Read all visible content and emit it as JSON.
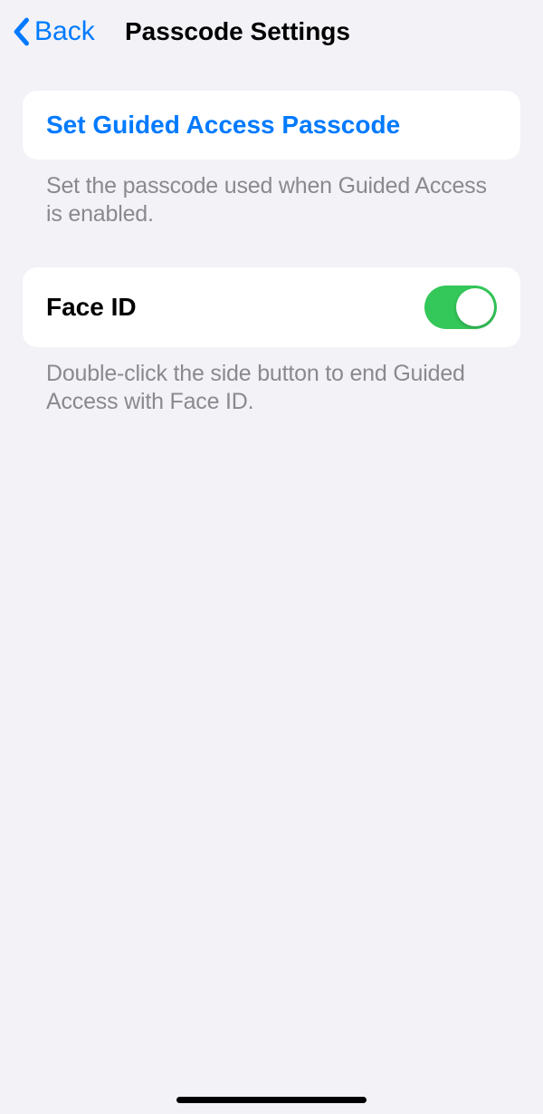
{
  "nav": {
    "back_label": "Back",
    "title": "Passcode Settings"
  },
  "sections": {
    "passcode": {
      "action_label": "Set Guided Access Passcode",
      "footer": "Set the passcode used when Guided Access is enabled."
    },
    "faceid": {
      "label": "Face ID",
      "toggle_on": true,
      "footer": "Double-click the side button to end Guided Access with Face ID."
    }
  }
}
